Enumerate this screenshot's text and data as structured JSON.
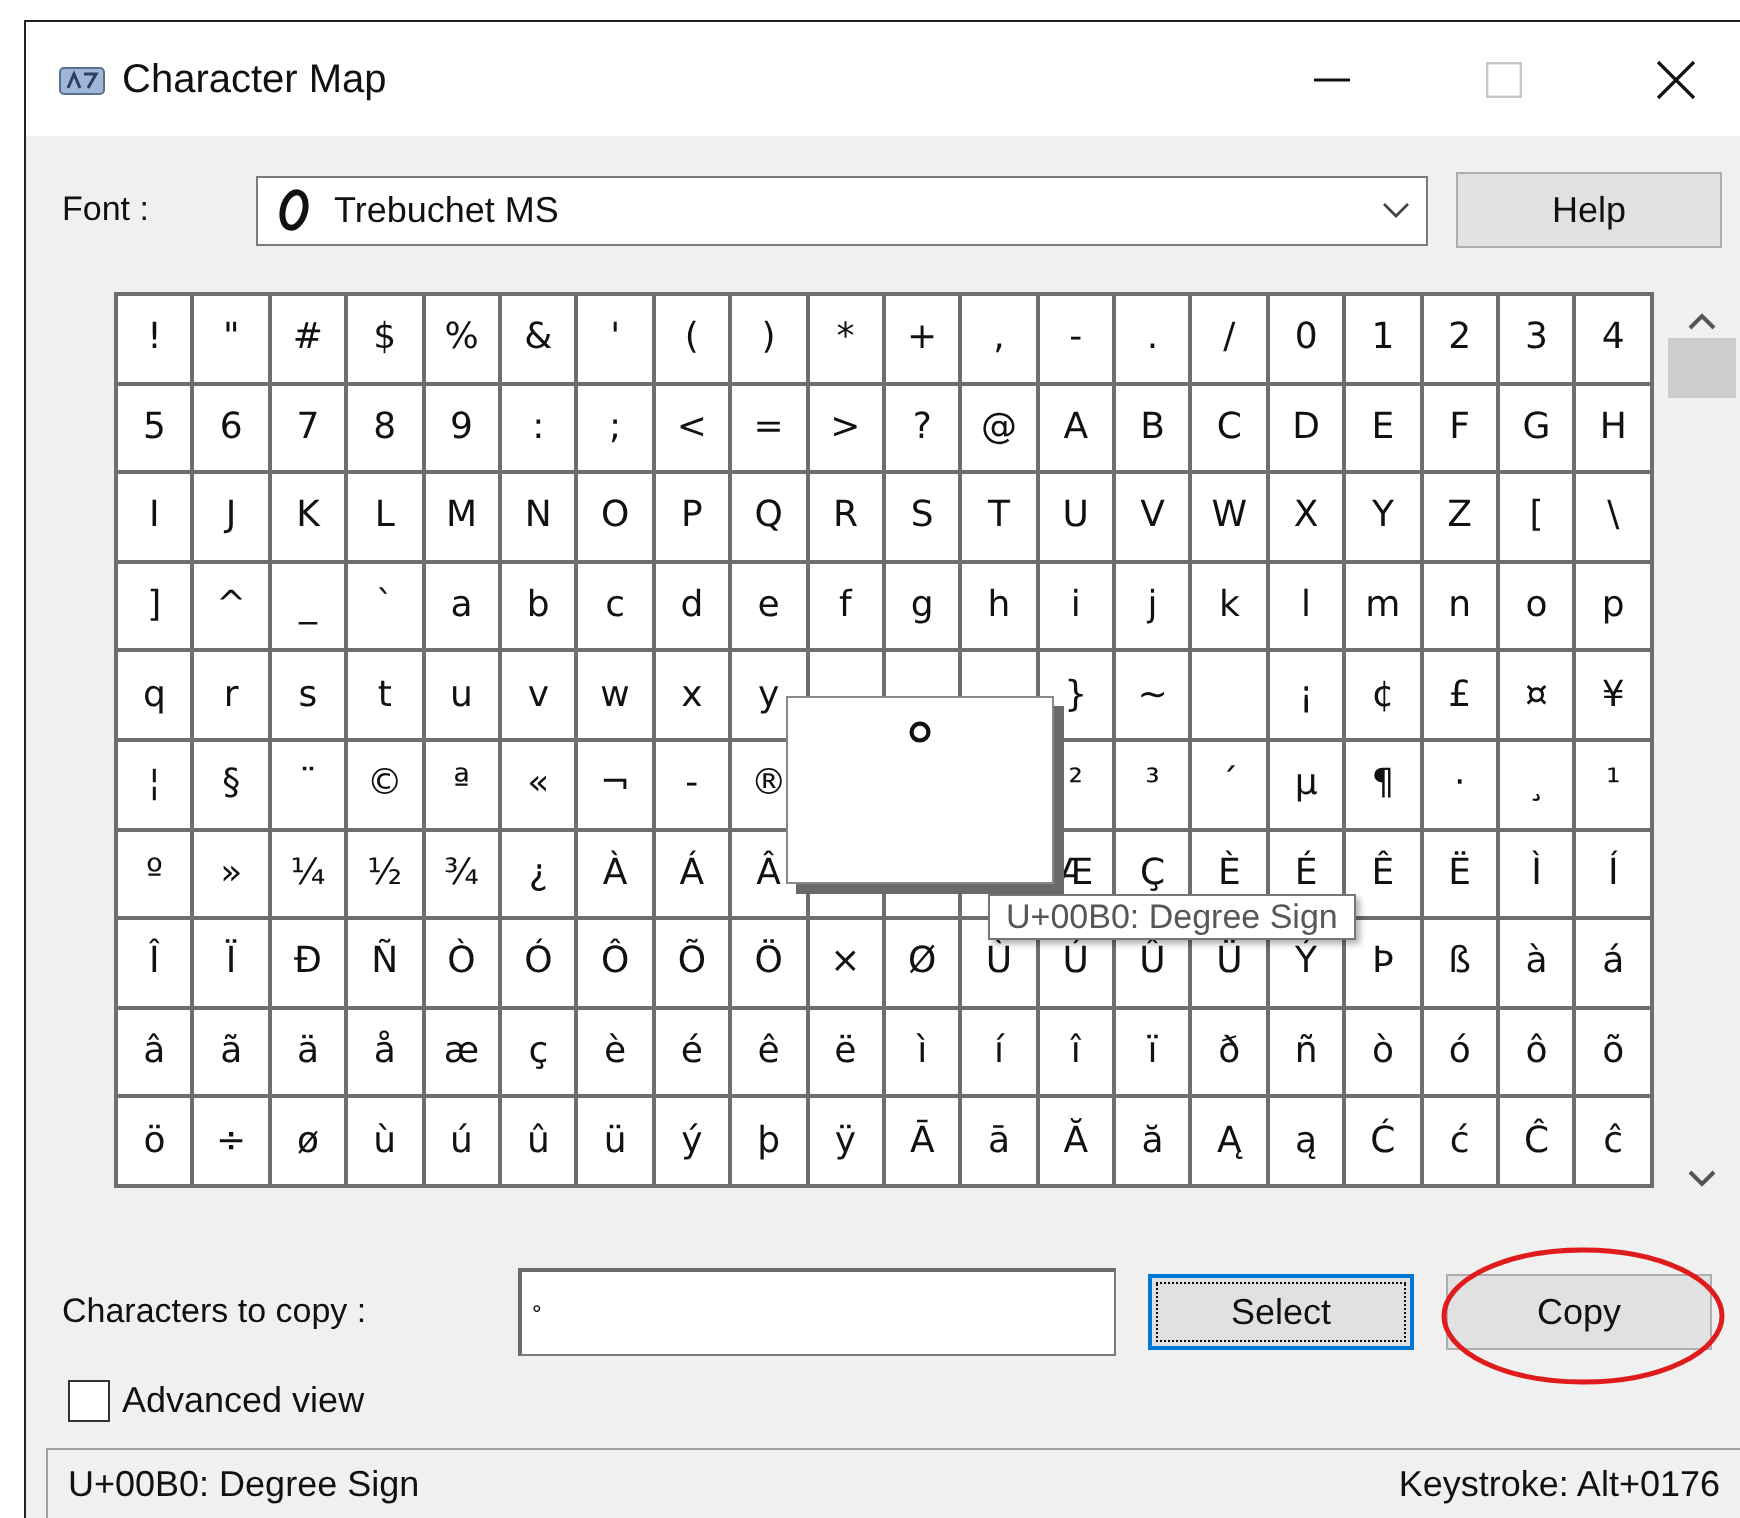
{
  "window": {
    "title": "Character Map",
    "controls": [
      {
        "kind": "minimize",
        "disabled": false
      },
      {
        "kind": "maximize",
        "disabled": true
      },
      {
        "kind": "close",
        "disabled": false
      }
    ]
  },
  "font": {
    "label": "Font :",
    "value": "Trebuchet MS"
  },
  "help_button": {
    "label": "Help"
  },
  "grid": {
    "rows": [
      [
        "!",
        "\"",
        "#",
        "$",
        "%",
        "&",
        "'",
        "(",
        ")",
        "*",
        "+",
        ",",
        "-",
        ".",
        "/",
        "0",
        "1",
        "2",
        "3",
        "4"
      ],
      [
        "5",
        "6",
        "7",
        "8",
        "9",
        ":",
        ";",
        "<",
        "=",
        ">",
        "?",
        "@",
        "A",
        "B",
        "C",
        "D",
        "E",
        "F",
        "G",
        "H"
      ],
      [
        "I",
        "J",
        "K",
        "L",
        "M",
        "N",
        "O",
        "P",
        "Q",
        "R",
        "S",
        "T",
        "U",
        "V",
        "W",
        "X",
        "Y",
        "Z",
        "[",
        "\\"
      ],
      [
        "]",
        "^",
        "_",
        "`",
        "a",
        "b",
        "c",
        "d",
        "e",
        "f",
        "g",
        "h",
        "i",
        "j",
        "k",
        "l",
        "m",
        "n",
        "o",
        "p"
      ],
      [
        "q",
        "r",
        "s",
        "t",
        "u",
        "v",
        "w",
        "x",
        "y",
        {
          "kind": "blank"
        },
        {
          "kind": "blank"
        },
        {
          "kind": "blank"
        },
        "}",
        "~",
        {
          "kind": "blank"
        },
        "¡",
        "¢",
        "£",
        "¤",
        "¥"
      ],
      [
        "¦",
        "§",
        "¨",
        "©",
        "ª",
        "«",
        "¬",
        "-",
        "®",
        null,
        null,
        null,
        "²",
        "³",
        "´",
        "µ",
        "¶",
        "·",
        "¸",
        "¹"
      ],
      [
        "º",
        "»",
        "¼",
        "½",
        "¾",
        "¿",
        "À",
        "Á",
        "Â",
        {
          "kind": "blank"
        },
        {
          "kind": "blank"
        },
        null,
        "Æ",
        "Ç",
        "È",
        "É",
        "Ê",
        "Ë",
        "Ì",
        "Í"
      ],
      [
        "Î",
        "Ï",
        "Ð",
        "Ñ",
        "Ò",
        "Ó",
        "Ô",
        "Õ",
        "Ö",
        "×",
        "Ø",
        "Ù",
        "Ú",
        "Û",
        "Ü",
        "Ý",
        "Þ",
        "ß",
        "à",
        "á"
      ],
      [
        "â",
        "ã",
        "ä",
        "å",
        "æ",
        "ç",
        "è",
        "é",
        "ê",
        "ë",
        "ì",
        "í",
        "î",
        "ï",
        "ð",
        "ñ",
        "ò",
        "ó",
        "ô",
        "õ"
      ],
      [
        "ö",
        "÷",
        "ø",
        "ù",
        "ú",
        "û",
        "ü",
        "ý",
        "þ",
        "ÿ",
        "Ā",
        "ā",
        "Ă",
        "ă",
        "Ą",
        "ą",
        "Ć",
        "ć",
        "Ĉ",
        "ĉ"
      ]
    ]
  },
  "zoom_popup": {
    "char": "°"
  },
  "tooltip": {
    "text": "U+00B0: Degree Sign"
  },
  "copy_field": {
    "label": "Characters to copy :",
    "value": "°"
  },
  "buttons": [
    {
      "label": "Select",
      "focused": true,
      "circled": false
    },
    {
      "label": "Copy",
      "focused": false,
      "circled": true
    }
  ],
  "advanced_view": {
    "label": "Advanced view",
    "checked": false
  },
  "status_bar": {
    "description": "U+00B0: Degree Sign",
    "keystroke": "Keystroke: Alt+0176"
  }
}
